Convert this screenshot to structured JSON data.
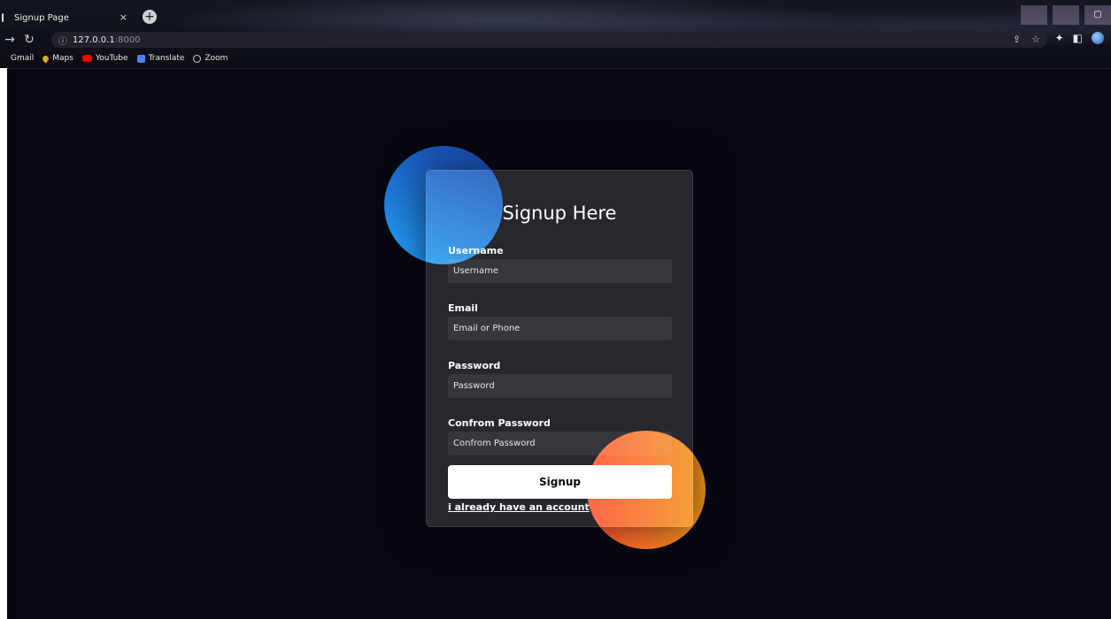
{
  "browser": {
    "tab_title": "Signup Page",
    "tab_close": "×",
    "new_tab": "+",
    "url_host": "127.0.0.1",
    "url_port": ":8000",
    "bookmarks": [
      "Gmail",
      "Maps",
      "YouTube",
      "Translate",
      "Zoom"
    ]
  },
  "form": {
    "title": "Signup Here",
    "username_label": "Username",
    "username_placeholder": "Username",
    "email_label": "Email",
    "email_placeholder": "Email or Phone",
    "password_label": "Password",
    "password_placeholder": "Password",
    "confirm_label": "Confrom Password",
    "confirm_placeholder": "Confrom Password",
    "submit_label": "Signup",
    "login_link": "i already have an account"
  },
  "colors": {
    "background": "#07070f",
    "blue_gradient": [
      "#1845ad",
      "#23a2f6"
    ],
    "orange_gradient": [
      "#ff512f",
      "#f09819"
    ]
  }
}
